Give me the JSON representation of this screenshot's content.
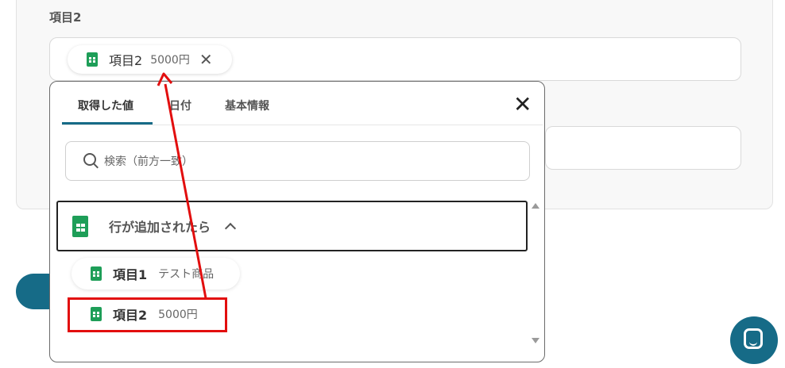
{
  "field": {
    "label": "項目2"
  },
  "chip": {
    "name": "項目2",
    "value": "5000円",
    "remove_glyph": "✕",
    "icon": "spreadsheet-icon"
  },
  "dropdown": {
    "tabs": [
      {
        "label": "取得した値",
        "active": true
      },
      {
        "label": "日付",
        "active": false
      },
      {
        "label": "基本情報",
        "active": false
      }
    ],
    "close_glyph": "✕",
    "search": {
      "placeholder": "検索（前方一致）"
    },
    "group": {
      "title": "行が追加されたら",
      "expanded": true,
      "icon": "spreadsheet-icon"
    },
    "items": [
      {
        "name": "項目1",
        "value": "テスト商品",
        "icon": "spreadsheet-icon"
      },
      {
        "name": "項目2",
        "value": "5000円",
        "icon": "spreadsheet-icon",
        "highlighted": true
      }
    ]
  },
  "colors": {
    "accent": "#166b87",
    "annotation": "#e20e0e",
    "sheet_green": "#1e9e58"
  }
}
